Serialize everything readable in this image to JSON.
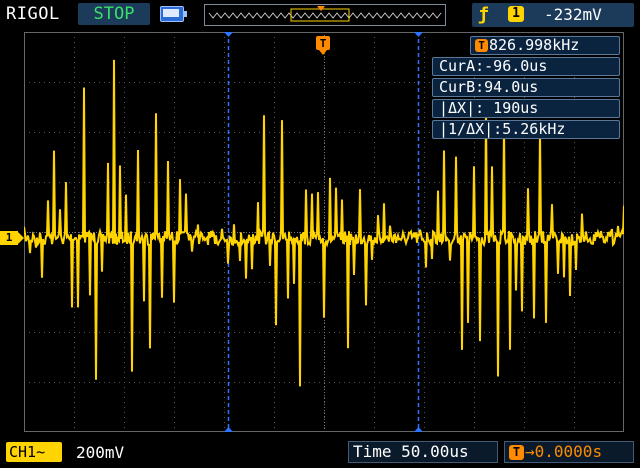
{
  "top": {
    "brand": "RIGOL",
    "run_state": "STOP",
    "trigger_channel": "1",
    "trigger_level": "-232mV",
    "trigger_edge_icon": "rising-edge-icon"
  },
  "measurements": {
    "frequency": "826.998kHz",
    "cursor_a": "CurA:-96.0us",
    "cursor_b": "CurB:94.0us",
    "delta_x": "|ΔX|: 190us",
    "inv_delta_x": "|1/ΔX|:5.26kHz"
  },
  "markers": {
    "channel_marker": "1",
    "trigger_marker": "T",
    "freq_badge": "T",
    "offset_badge": "T"
  },
  "bottom": {
    "channel_label": "CH1",
    "coupling_symbol": "~",
    "volts_per_div": "200mV",
    "timebase": "Time 50.00us",
    "offset": "0.0000s"
  },
  "colors": {
    "trace": "#ffd400",
    "grid": "#3a3a3a",
    "cursor": "#2f74ff",
    "trigger": "#ff8a00"
  }
}
